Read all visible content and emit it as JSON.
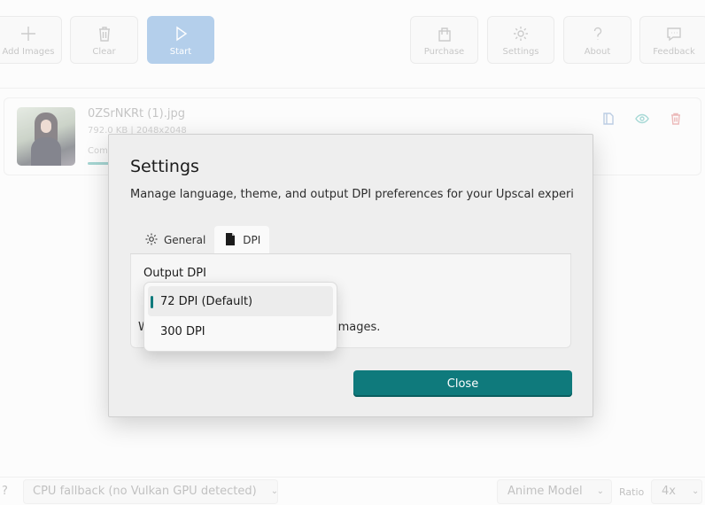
{
  "toolbar": {
    "add_images": "Add Images",
    "clear": "Clear",
    "start": "Start",
    "purchase": "Purchase",
    "settings": "Settings",
    "about": "About",
    "feedback": "Feedback"
  },
  "file": {
    "name": "0ZSrNKRt (1).jpg",
    "meta": "792.0 KB  |  2048x2048",
    "status": "Com"
  },
  "statusbar": {
    "help": "?",
    "device": "CPU fallback (no Vulkan GPU detected)",
    "model": "Anime Model",
    "ratio_label": "Ratio",
    "ratio_value": "4x"
  },
  "dialog": {
    "title": "Settings",
    "description": "Manage language, theme, and output DPI preferences for your Upscal experience",
    "tabs": [
      {
        "label": "General",
        "icon": "gear-icon"
      },
      {
        "label": "DPI",
        "icon": "document-icon"
      }
    ],
    "output_dpi_label": "Output DPI",
    "hint_prefix": "W",
    "hint_suffix": "images.",
    "close_label": "Close"
  },
  "dropdown": {
    "options": [
      "72 DPI (Default)",
      "300 DPI"
    ],
    "selected": "72 DPI (Default)"
  },
  "colors": {
    "accent": "#0f7a7c",
    "primary_button": "#9fc2e6"
  }
}
